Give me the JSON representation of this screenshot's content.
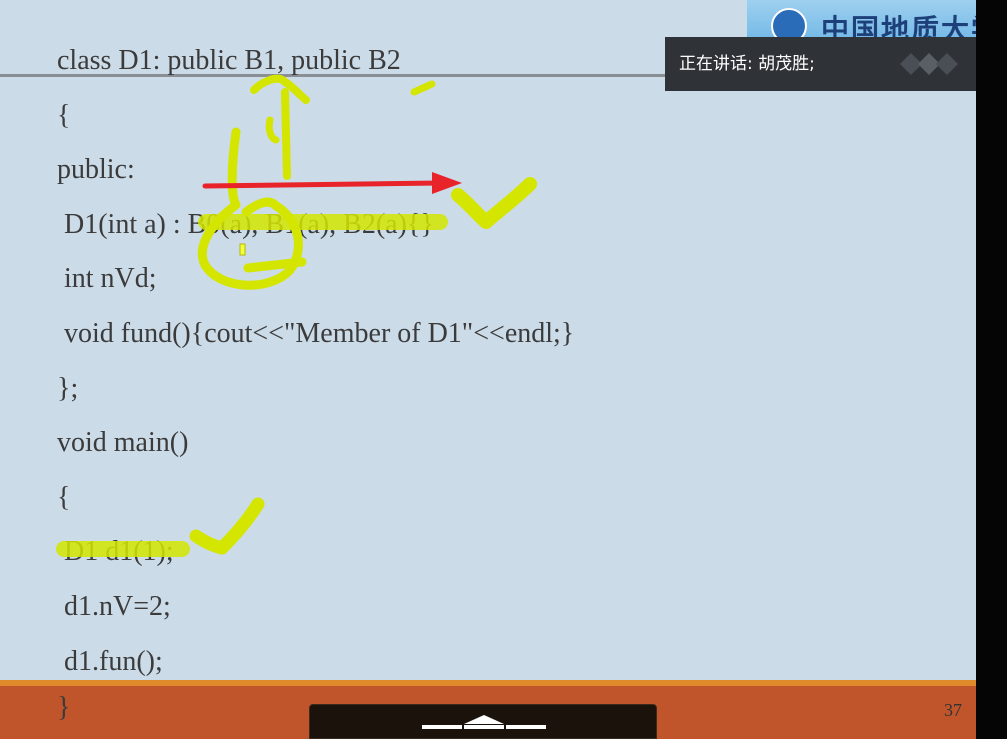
{
  "slide": {
    "logo": {
      "text": "中国地质大学"
    },
    "code_lines": [
      "class D1: public B1, public B2",
      "{",
      "public:",
      " D1(int a) : B0(a), B1(a), B2(a){}",
      " int nVd;",
      " void fund(){cout<<\"Member of D1\"<<endl;}",
      "};",
      "void main()",
      "{",
      " D1 d1(1);",
      " d1.nV=2;",
      " d1.fun();"
    ],
    "last_line": "}",
    "page_number": "37"
  },
  "speaker_bar": {
    "label": "正在讲话: 胡茂胜;"
  },
  "toolbar": {
    "icon": "collapse-up-icon"
  },
  "colors": {
    "slide_bg": "#cbdbe8",
    "highlight": "#d4e600",
    "arrow": "#e8232a",
    "band": "#c0552b"
  }
}
